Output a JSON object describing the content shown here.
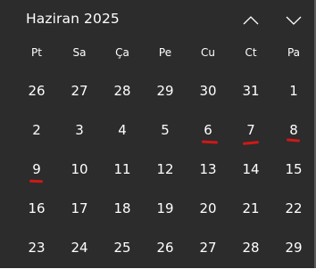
{
  "calendar": {
    "month_title": "Haziran 2025",
    "weekdays": [
      "Pt",
      "Sa",
      "Ça",
      "Pe",
      "Cu",
      "Ct",
      "Pa"
    ],
    "weeks": [
      [
        "26",
        "27",
        "28",
        "29",
        "30",
        "31",
        "1"
      ],
      [
        "2",
        "3",
        "4",
        "5",
        "6",
        "7",
        "8"
      ],
      [
        "9",
        "10",
        "11",
        "12",
        "13",
        "14",
        "15"
      ],
      [
        "16",
        "17",
        "18",
        "19",
        "20",
        "21",
        "22"
      ],
      [
        "23",
        "24",
        "25",
        "26",
        "27",
        "28",
        "29"
      ]
    ],
    "underlined_days": [
      "6",
      "7",
      "8",
      "9"
    ],
    "colors": {
      "background": "#2c2c2c",
      "text": "#ffffff",
      "underline_mark": "#d01818"
    }
  },
  "icons": {
    "prev": "chevron-up-icon",
    "next": "chevron-down-icon"
  }
}
